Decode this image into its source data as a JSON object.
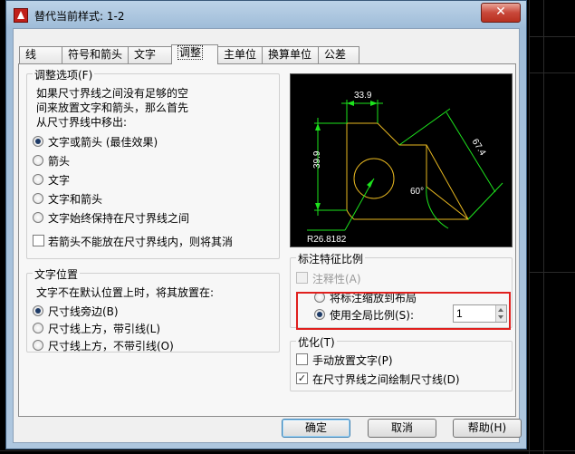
{
  "dialog": {
    "title": "替代当前样式: 1-2",
    "close_glyph": "✕"
  },
  "tabs": [
    {
      "label": "线"
    },
    {
      "label": "符号和箭头"
    },
    {
      "label": "文字"
    },
    {
      "label": "调整",
      "active": true
    },
    {
      "label": "主单位"
    },
    {
      "label": "换算单位"
    },
    {
      "label": "公差"
    }
  ],
  "fit_options": {
    "title": "调整选项(F)",
    "description": [
      "如果尺寸界线之间没有足够的空",
      "间来放置文字和箭头，那么首先",
      "从尺寸界线中移出:"
    ],
    "options": [
      {
        "label": "文字或箭头 (最佳效果)",
        "checked": true
      },
      {
        "label": "箭头",
        "checked": false
      },
      {
        "label": "文字",
        "checked": false
      },
      {
        "label": "文字和箭头",
        "checked": false
      },
      {
        "label": "文字始终保持在尺寸界线之间",
        "checked": false
      }
    ],
    "suppress_arrows": "若箭头不能放在尺寸界线内，则将其消"
  },
  "text_placement": {
    "title": "文字位置",
    "description": "文字不在默认位置上时，将其放置在:",
    "options": [
      {
        "label": "尺寸线旁边(B)",
        "checked": true
      },
      {
        "label": "尺寸线上方，带引线(L)",
        "checked": false
      },
      {
        "label": "尺寸线上方，不带引线(O)",
        "checked": false
      }
    ]
  },
  "preview": {
    "dim_top": "33.9",
    "dim_left": "39.9",
    "dim_slant": "67.4",
    "dim_angle": "60°",
    "dim_radius": "R26.8182"
  },
  "scale": {
    "title": "标注特征比例",
    "annotative": "注释性(A)",
    "scale_to_layout": "将标注缩放到布局",
    "use_overall": "使用全局比例(S):",
    "overall_value": "1"
  },
  "fine_tuning": {
    "title": "优化(T)",
    "manual_place": "手动放置文字(P)",
    "draw_dimline": "在尺寸界线之间绘制尺寸线(D)",
    "manual_place_checked": "",
    "draw_dimline_checked": "✓"
  },
  "buttons": {
    "ok": "确定",
    "cancel": "取消",
    "help": "帮助(H)"
  },
  "colors": {
    "preview_lines": "#e8b820",
    "dimension": "#1de31d",
    "text_white": "#ffffff",
    "highlight": "#e0201e"
  }
}
